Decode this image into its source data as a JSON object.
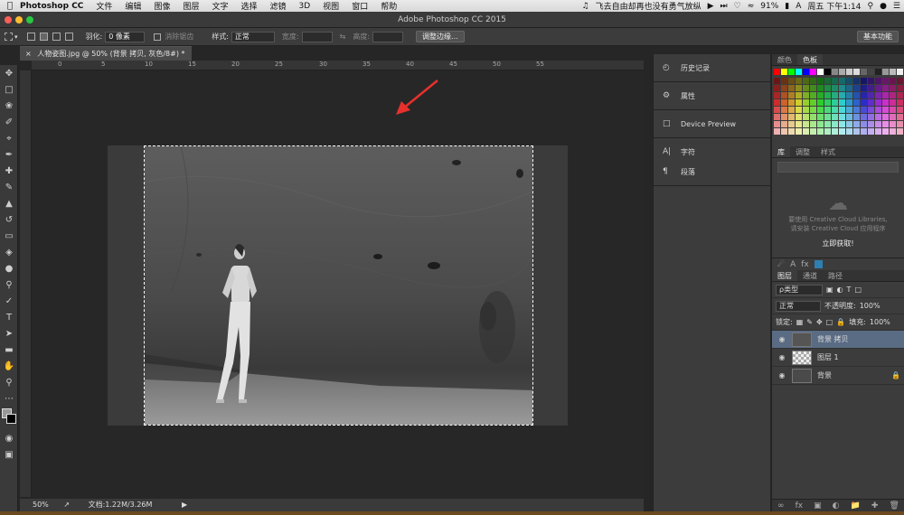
{
  "menubar": {
    "app_name": "Photoshop CC",
    "items": [
      "文件",
      "编辑",
      "图像",
      "图层",
      "文字",
      "选择",
      "滤镜",
      "3D",
      "视图",
      "窗口",
      "帮助"
    ],
    "now_playing": "飞去自由却再也没有勇气放纵",
    "battery": "91%",
    "clock": "周五 下午1:14"
  },
  "window": {
    "title": "Adobe Photoshop CC 2015"
  },
  "options": {
    "feather_label": "羽化:",
    "feather_value": "0 像素",
    "antialias_label": "消除锯齿",
    "style_label": "样式:",
    "style_value": "正常",
    "width_label": "宽度:",
    "height_label": "高度:",
    "refine_button": "调整边缘...",
    "workspace": "基本功能"
  },
  "document": {
    "tab_label": "人物姿图.jpg @ 50% (背景 拷贝, 灰色/8#) *",
    "ruler_marks": [
      "0",
      "5",
      "10",
      "15",
      "20",
      "25",
      "30",
      "35",
      "40",
      "45",
      "50",
      "55"
    ],
    "zoom": "50%",
    "doc_info": "文档:1.22M/3.26M"
  },
  "dock": {
    "items": [
      "历史记录",
      "属性",
      "Device Preview",
      "字符",
      "段落"
    ]
  },
  "swatches_panel": {
    "tabs": [
      "颜色",
      "色板"
    ]
  },
  "library_panel": {
    "tabs": [
      "库",
      "调整",
      "样式"
    ],
    "message_line1": "要使用 Creative Cloud Libraries,",
    "message_line2": "请安装 Creative Cloud 应用程序",
    "get_button": "立即获取!"
  },
  "layers_panel": {
    "tabs": [
      "图层",
      "通道",
      "路径"
    ],
    "filter_kind": "ρ类型",
    "blend_mode": "正常",
    "opacity_label": "不透明度:",
    "opacity_value": "100%",
    "lock_label": "锁定:",
    "fill_label": "填充:",
    "fill_value": "100%",
    "layers": [
      {
        "name": "背景 拷贝",
        "selected": true
      },
      {
        "name": "图层 1",
        "selected": false
      },
      {
        "name": "背景",
        "selected": false
      }
    ]
  },
  "colors": {
    "accent": "#e8302c",
    "selection": "#5a6c84"
  }
}
